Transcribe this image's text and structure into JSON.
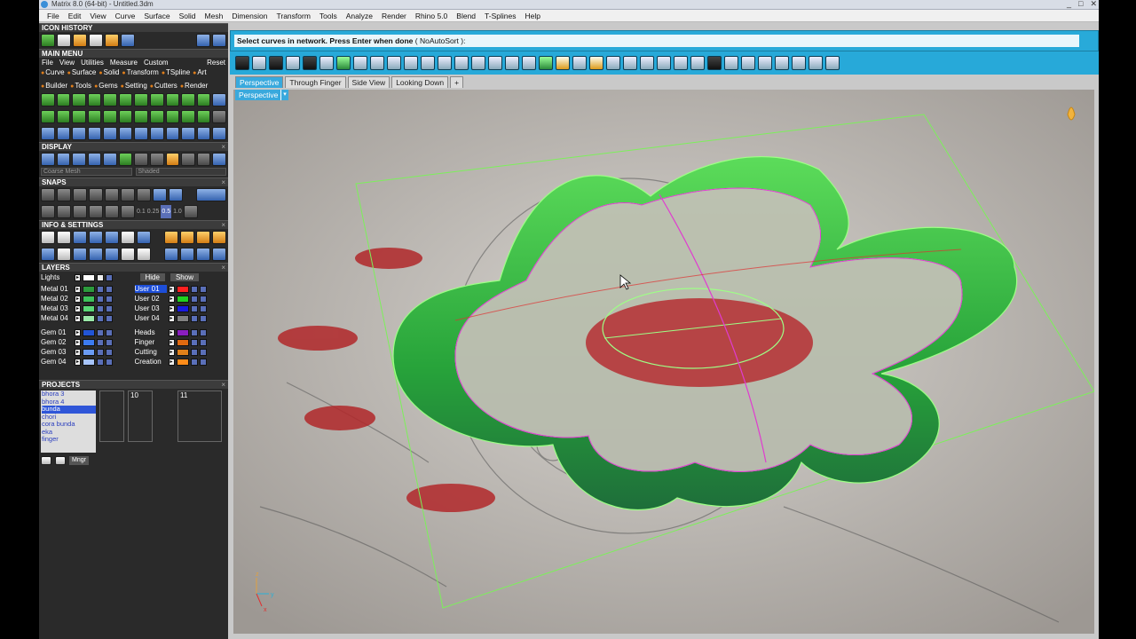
{
  "window": {
    "title": "Matrix 8.0 (64-bit) - Untitled.3dm",
    "controls": [
      "_",
      "□",
      "✕"
    ]
  },
  "menubar": {
    "items": [
      "File",
      "Edit",
      "View",
      "Curve",
      "Surface",
      "Solid",
      "Mesh",
      "Dimension",
      "Transform",
      "Tools",
      "Analyze",
      "Render",
      "Rhino 5.0",
      "Blend",
      "T-Splines",
      "Help"
    ]
  },
  "left": {
    "icon_history": "ICON HISTORY",
    "main_menu": "MAIN MENU",
    "mm_menu": [
      "File",
      "View",
      "Utilities",
      "Measure",
      "Custom"
    ],
    "mm_reset": "Reset",
    "mm_categories": [
      "Curve",
      "Surface",
      "Solid",
      "Transform",
      "TSpline",
      "Art",
      "Builder",
      "Tools",
      "Gems",
      "Setting",
      "Cutters",
      "Render"
    ],
    "display": "DISPLAY",
    "display_combo1": "Coarse Mesh",
    "display_combo2": "Shaded",
    "snaps": "SNAPS",
    "snap_values": [
      "0.1",
      "0.25",
      "0.5",
      "1.0"
    ],
    "info": "INFO & SETTINGS",
    "layers": "LAYERS",
    "lights": "Lights",
    "hide": "Hide",
    "show": "Show",
    "layers_left": [
      "Metal 01",
      "Metal 02",
      "Metal 03",
      "Metal 04",
      "Gem 01",
      "Gem 02",
      "Gem 03",
      "Gem 04"
    ],
    "layers_right": [
      "User 01",
      "User 02",
      "User 03",
      "User 04",
      "Heads",
      "Finger",
      "Cutting",
      "Creation"
    ],
    "colors_left": [
      "#2c9a3c",
      "#3ec25a",
      "#5ad876",
      "#9ae8a8",
      "#2255d6",
      "#3c7bf0",
      "#6a9bf5",
      "#a7c4fa"
    ],
    "colors_right": [
      "#ff2020",
      "#20d020",
      "#1a1ae0",
      "#808080",
      "#8a1ec0",
      "#e06a10",
      "#e0801a",
      "#ff8c1a"
    ],
    "projects": "PROJECTS",
    "project_list": [
      "bhora 3",
      "bhora 4",
      "bunda",
      "chori",
      "cora bunda",
      "eka",
      "finger"
    ],
    "project_selected": "bunda",
    "thumb_labels": [
      "",
      "10",
      "11"
    ],
    "manage": "Mngr",
    "close": "×"
  },
  "command": {
    "prompt": "Select curves in network. Press Enter when done",
    "option": "( NoAutoSort ):"
  },
  "viewport_tabs": [
    "Perspective",
    "Through Finger",
    "Side View",
    "Looking Down"
  ],
  "viewport_label": "Perspective",
  "viewport_arrow": "▾",
  "tab_add": "+",
  "axis": {
    "x": "x",
    "y": "y",
    "z": "z"
  },
  "theme": {
    "accent": "#28aad9",
    "surface": "#2fb347",
    "boundary": "#7cf05a",
    "curve": "#e03bd0"
  }
}
